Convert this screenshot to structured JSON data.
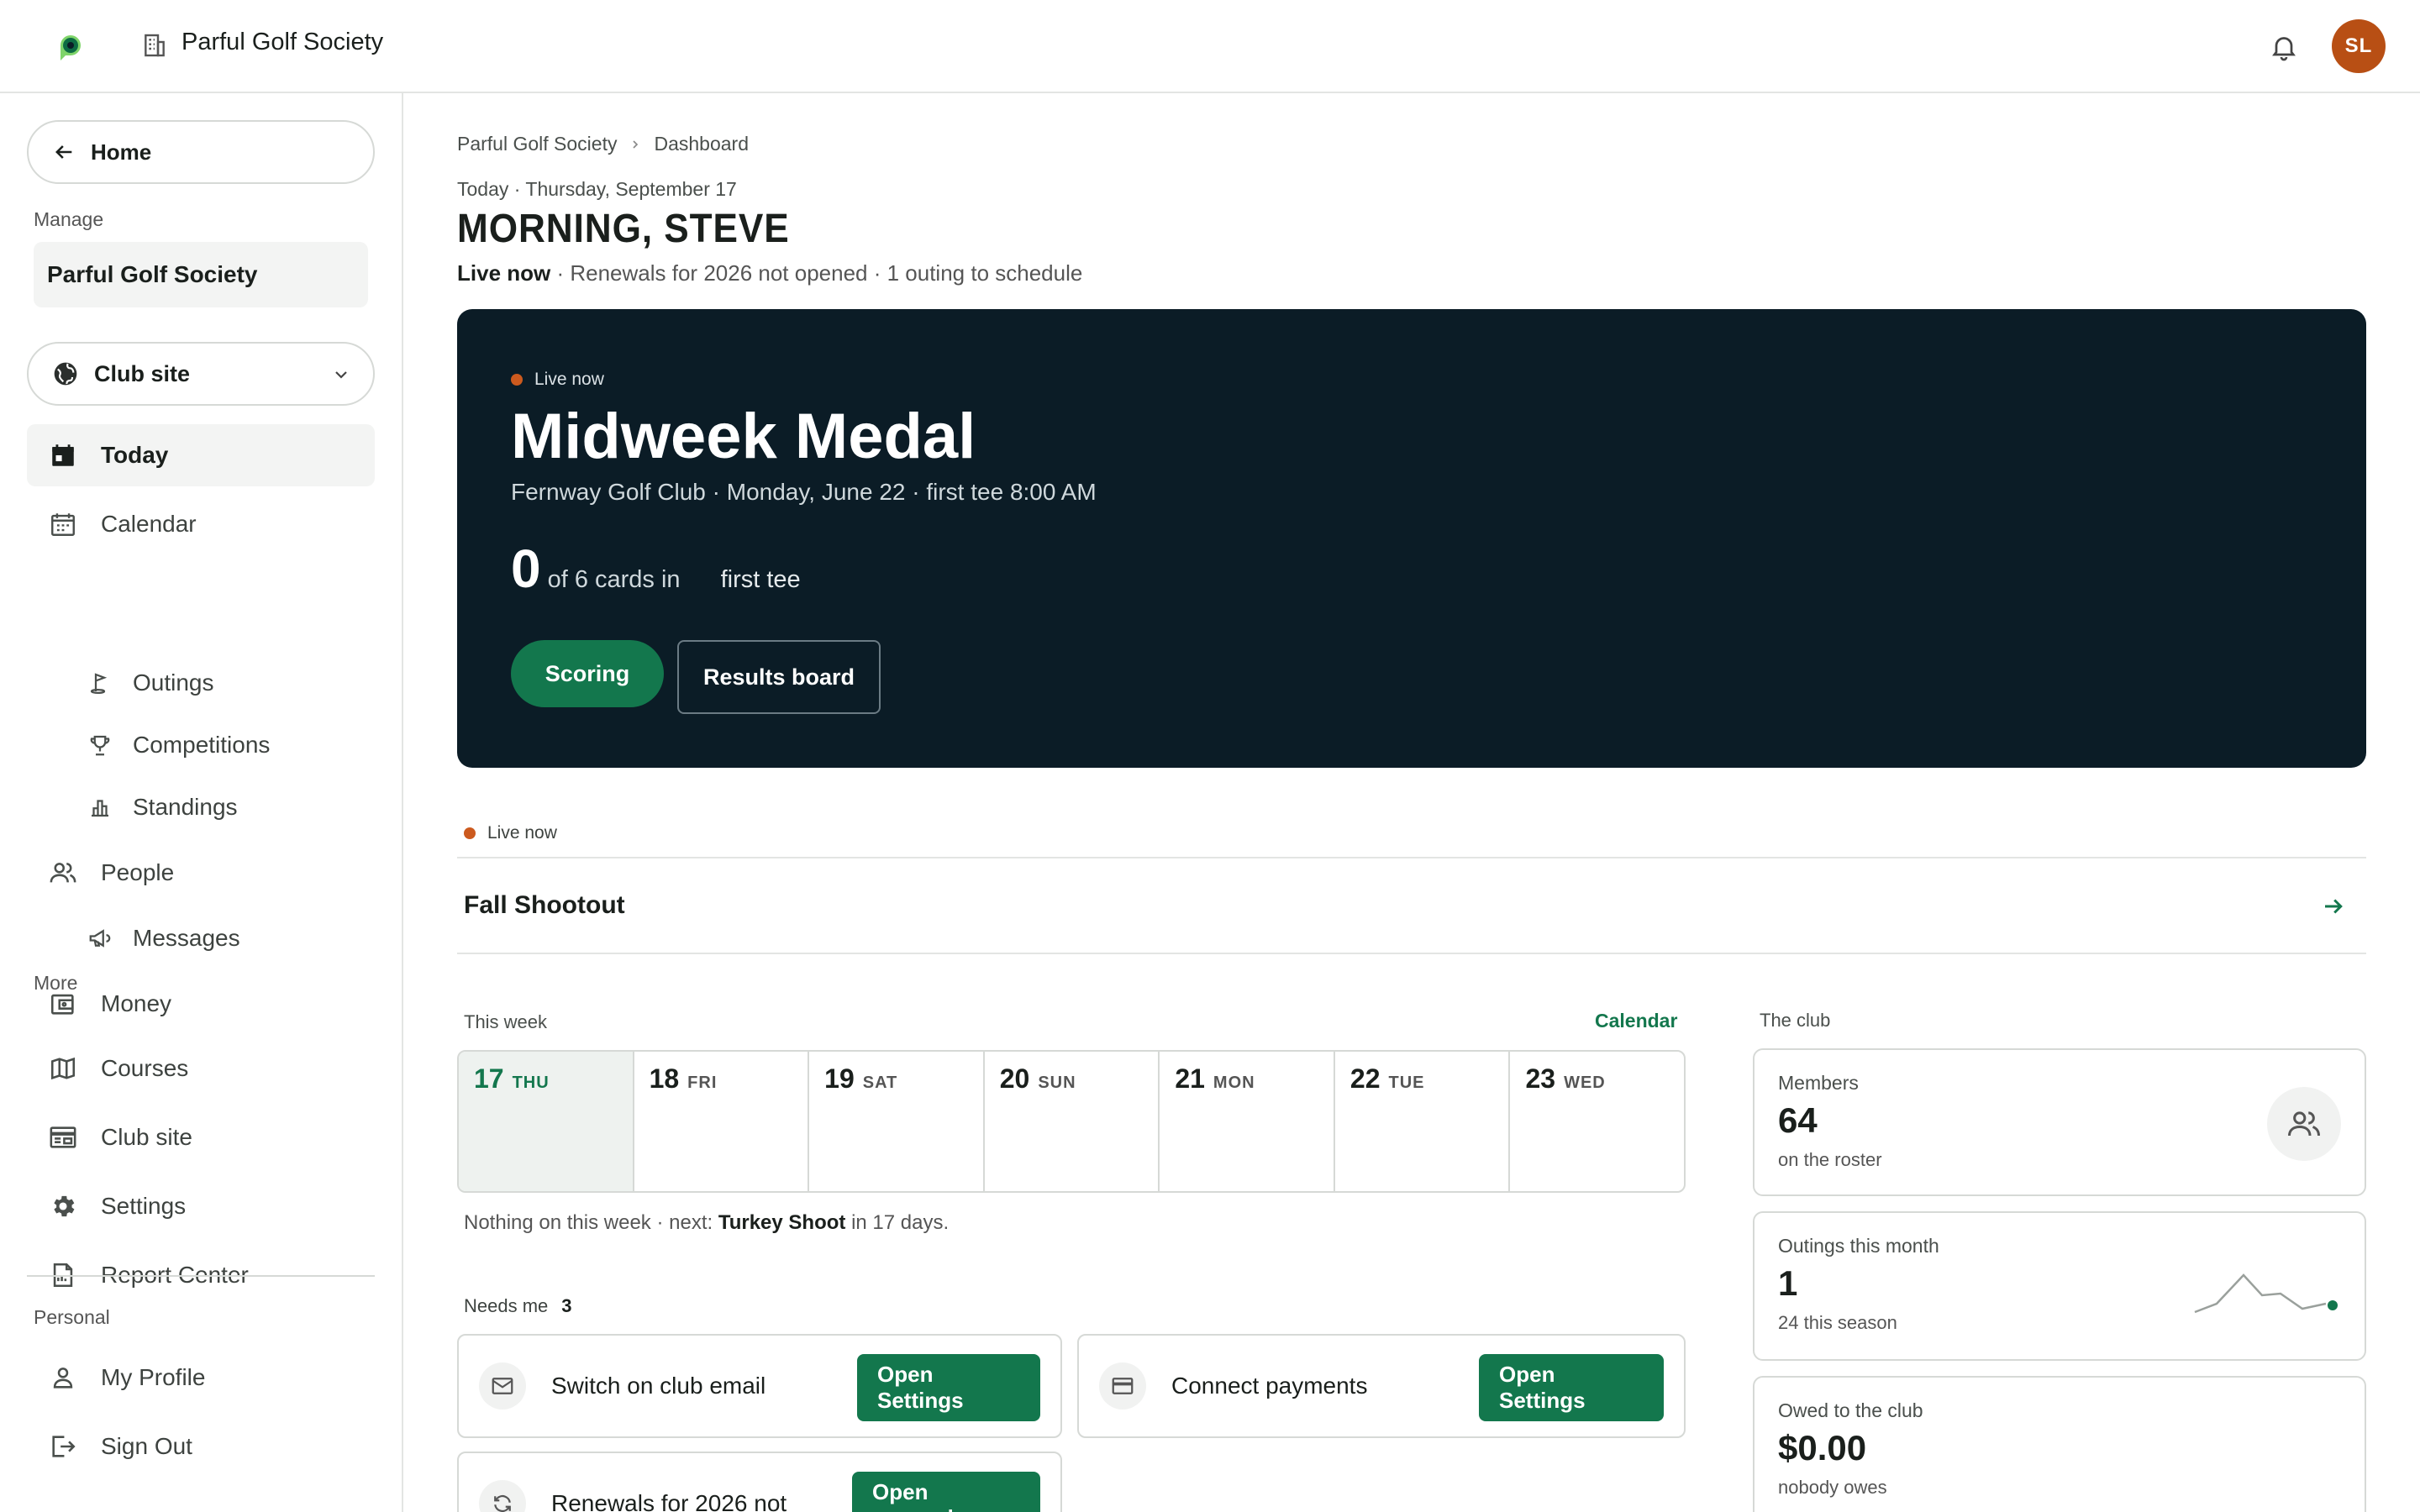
{
  "topbar": {
    "org_name": "Parful Golf Society",
    "avatar_initials": "SL",
    "avatar_color": "#b84f14",
    "logo_icon": "app-logo-icon",
    "org_icon": "building-icon",
    "bell_icon": "bell-icon"
  },
  "sidebar": {
    "home_label": "Home",
    "manage_label": "Manage",
    "org_chip": "Parful Golf Society",
    "site_select": "Club site",
    "more_label": "More",
    "personal_label": "Personal",
    "items": [
      {
        "label": "Today",
        "icon": "calendar-today-icon",
        "active": true
      },
      {
        "label": "Calendar",
        "icon": "calendar-icon"
      },
      {
        "label": "Outings",
        "icon": "golf-flag-icon"
      },
      {
        "label": "Competitions",
        "icon": "trophy-icon"
      },
      {
        "label": "Standings",
        "icon": "bar-chart-icon"
      },
      {
        "label": "People",
        "icon": "people-icon"
      },
      {
        "label": "Messages",
        "icon": "megaphone-icon"
      },
      {
        "label": "Money",
        "icon": "wallet-icon"
      },
      {
        "label": "Courses",
        "icon": "map-icon"
      },
      {
        "label": "Club site",
        "icon": "web-icon"
      },
      {
        "label": "Settings",
        "icon": "gear-icon"
      },
      {
        "label": "Report Center",
        "icon": "report-icon"
      },
      {
        "label": "My Profile",
        "icon": "person-icon"
      },
      {
        "label": "Sign Out",
        "icon": "sign-out-icon"
      }
    ]
  },
  "main": {
    "breadcrumb": [
      "Parful Golf Society",
      "Dashboard"
    ],
    "today_line": "Today · Thursday, September 17",
    "greeting": "MORNING, STEVE",
    "status_bold": "Live now",
    "status_rest": " · Renewals for 2026 not opened · 1 outing to schedule",
    "hero": {
      "live_label": "Live now",
      "title": "Midweek Medal",
      "subtitle": "Fernway Golf Club · Monday, June 22 · first tee 8:00 AM",
      "cards_in": "0",
      "cards_total_text": "of 6 cards in",
      "tee_text": "first tee",
      "scoring_label": "Scoring",
      "results_label": "Results board"
    },
    "live2_label": "Live now",
    "fall_event": "Fall Shootout",
    "week": {
      "label": "This week",
      "link": "Calendar",
      "days": [
        {
          "num": "17",
          "dow": "THU",
          "today": true
        },
        {
          "num": "18",
          "dow": "FRI"
        },
        {
          "num": "19",
          "dow": "SAT"
        },
        {
          "num": "20",
          "dow": "SUN"
        },
        {
          "num": "21",
          "dow": "MON"
        },
        {
          "num": "22",
          "dow": "TUE"
        },
        {
          "num": "23",
          "dow": "WED"
        }
      ],
      "note_pre": "Nothing on this week · next: ",
      "note_bold": "Turkey Shoot",
      "note_post": " in 17 days."
    },
    "needs": {
      "label": "Needs me",
      "count": "3",
      "tasks": [
        {
          "label": "Switch on club email",
          "button": "Open Settings",
          "icon": "mail-icon"
        },
        {
          "label": "Connect payments",
          "button": "Open Settings",
          "icon": "credit-card-icon"
        },
        {
          "label": "Renewals for 2026 not",
          "button": "Open renewals",
          "icon": "renew-icon"
        }
      ]
    },
    "club": {
      "label": "The club",
      "members": {
        "label": "Members",
        "value": "64",
        "sub": "on the roster"
      },
      "outings": {
        "label": "Outings this month",
        "value": "1",
        "sub": "24 this season"
      },
      "owed": {
        "label": "Owed to the club",
        "value": "$0.00",
        "sub": "nobody owes"
      }
    }
  },
  "colors": {
    "accent_green": "#13774d",
    "hero_bg": "#0b1c26",
    "live_dot": "#cc5a1e"
  }
}
